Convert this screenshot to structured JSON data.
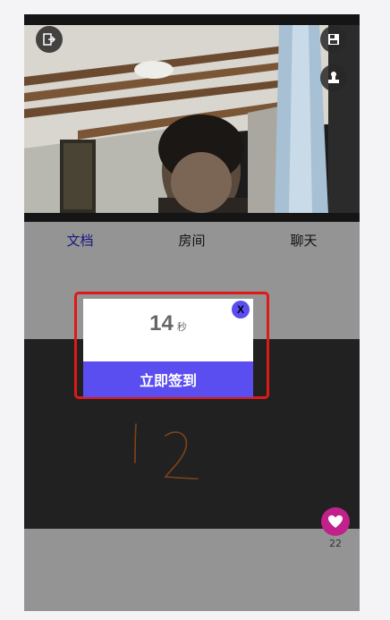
{
  "video": {
    "top_left_icon": "exit-icon",
    "top_right_icons": [
      "save-icon",
      "stamp-icon"
    ]
  },
  "tabs": [
    {
      "label": "文档",
      "active": true
    },
    {
      "label": "房间",
      "active": false
    },
    {
      "label": "聊天",
      "active": false
    }
  ],
  "whiteboard": {
    "handwriting": "12",
    "stroke_color": "#d9742a"
  },
  "likes": {
    "icon": "heart-icon",
    "count": "22",
    "color": "#c0218a"
  },
  "checkin_dialog": {
    "countdown_value": "14",
    "countdown_unit": "秒",
    "close_label": "X",
    "button_label": "立即签到",
    "accent_color": "#5b4ef0",
    "highlight_color": "#e01818"
  }
}
